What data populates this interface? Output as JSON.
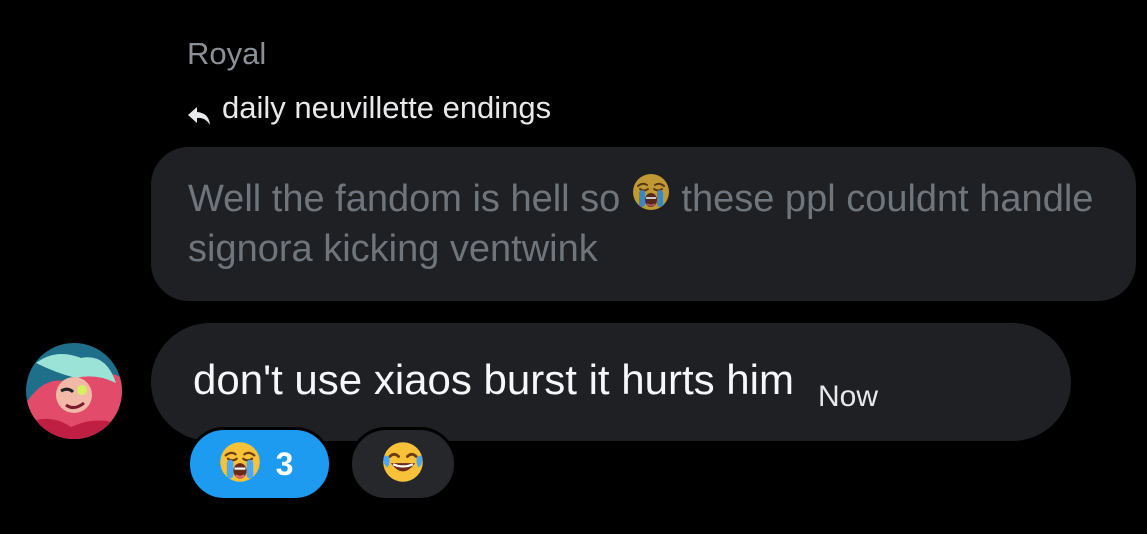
{
  "sender_name": "Royal",
  "reply": {
    "label": "daily neuvillette endings",
    "icon": "reply-arrow-icon"
  },
  "quoted_message": {
    "text_before_emoji": "Well the fandom is hell so ",
    "emoji": "loudly-crying-face",
    "text_after_emoji": " these ppl couldnt handle signora kicking ventwink"
  },
  "message": {
    "text": "don't use xiaos burst it hurts him",
    "timestamp": "Now",
    "avatar": "avatar-image"
  },
  "reactions": [
    {
      "emoji": "loudly-crying-face",
      "count": "3",
      "active": true
    },
    {
      "emoji": "face-with-tears-of-joy",
      "count": "",
      "active": false
    }
  ],
  "colors": {
    "background": "#000000",
    "bubble": "#1f2024",
    "muted_text": "#6f757b",
    "accent": "#1d9bf0"
  }
}
